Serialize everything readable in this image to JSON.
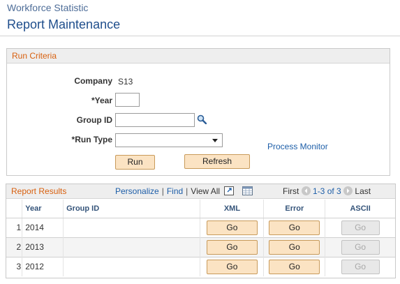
{
  "breadcrumb": "Workforce Statistic",
  "page_title": "Report Maintenance",
  "run_criteria": {
    "header": "Run Criteria",
    "company_label": "Company",
    "company_value": "S13",
    "year_label": "*Year",
    "year_value": "",
    "group_id_label": "Group ID",
    "group_id_value": "",
    "run_type_label": "*Run Type",
    "run_type_value": "",
    "process_monitor_link": "Process Monitor",
    "run_button": "Run",
    "refresh_button": "Refresh"
  },
  "report_results": {
    "header": "Report Results",
    "nav": {
      "personalize": "Personalize",
      "separator": "|",
      "find": "Find",
      "view_all": "View All",
      "first": "First",
      "range": "1-3 of 3",
      "last": "Last"
    },
    "columns": [
      "Year",
      "Group ID",
      "XML",
      "Error",
      "ASCII"
    ],
    "rows": [
      {
        "num": "1",
        "year": "2014",
        "group_id": "",
        "xml": "Go",
        "error": "Go",
        "ascii": "Go"
      },
      {
        "num": "2",
        "year": "2013",
        "group_id": "",
        "xml": "Go",
        "error": "Go",
        "ascii": "Go"
      },
      {
        "num": "3",
        "year": "2012",
        "group_id": "",
        "xml": "Go",
        "error": "Go",
        "ascii": "Go"
      }
    ]
  },
  "colors": {
    "section_header_text": "#d8600e",
    "link": "#1d5ea8",
    "title": "#1f4e8c",
    "button_bg": "#fbe3c3"
  }
}
